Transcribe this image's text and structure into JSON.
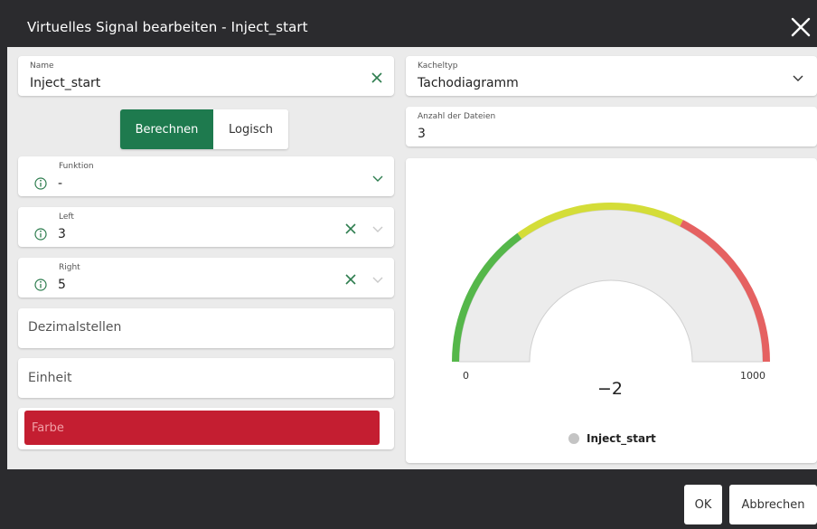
{
  "dialog": {
    "title": "Virtuelles Signal bearbeiten - Inject_start"
  },
  "form": {
    "name": {
      "label": "Name",
      "value": "Inject_start"
    },
    "tile_type": {
      "label": "Kacheltyp",
      "value": "Tachodiagramm"
    },
    "file_count": {
      "label": "Anzahl der Dateien",
      "value": "3"
    },
    "mode_tabs": [
      {
        "label": "Berechnen",
        "active": true
      },
      {
        "label": "Logisch",
        "active": false
      }
    ],
    "function": {
      "label": "Funktion",
      "value": "-"
    },
    "left": {
      "label": "Left",
      "value": "3"
    },
    "right": {
      "label": "Right",
      "value": "5"
    },
    "decimals": {
      "placeholder": "Dezimalstellen"
    },
    "unit": {
      "placeholder": "Einheit"
    },
    "color": {
      "label": "Farbe",
      "value": "#c41e31"
    }
  },
  "gauge": {
    "min_label": "0",
    "max_label": "1000",
    "value_text": "−2",
    "legend": "Inject_start",
    "legend_color": "#c4c4c4",
    "bands": [
      {
        "color": "#55b74a",
        "from": 0,
        "to": 0.3
      },
      {
        "color": "#d4dd38",
        "from": 0.3,
        "to": 0.65
      },
      {
        "color": "#e56161",
        "from": 0.65,
        "to": 1
      }
    ]
  },
  "footer": {
    "ok_label": "OK",
    "cancel_label": "Abbrechen"
  },
  "colors": {
    "accent_green": "#1e7a4e",
    "icon_green": "#2e7d4f",
    "dialog_bg": "#2b2b2e",
    "content_bg": "#ebebeb"
  }
}
